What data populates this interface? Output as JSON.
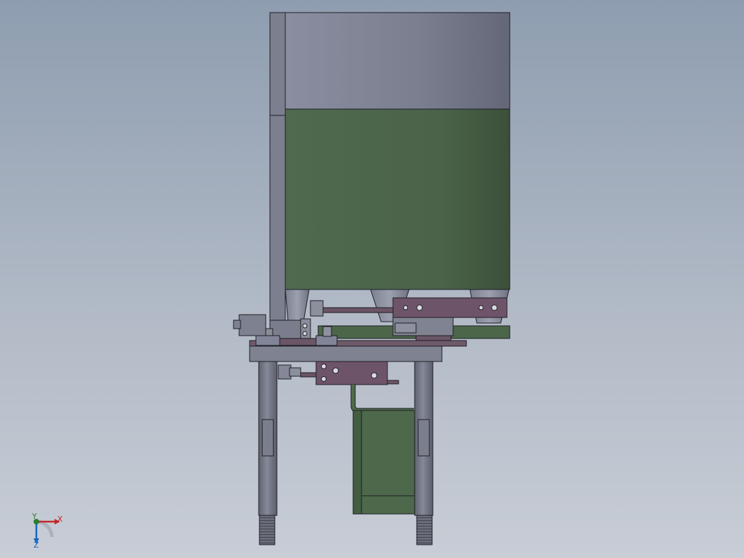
{
  "viewport": {
    "background_top": "#8e9db0",
    "background_bottom": "#c8cdd6"
  },
  "colors": {
    "hopper_steel": "#7a7f8e",
    "hopper_green": "#4f6a4e",
    "frame_gray": "#7c7f8c",
    "cylinder_purple": "#6e5468",
    "edge": "#1e1e24",
    "tube_green": "#4e6b4b"
  },
  "triad": {
    "x_label": "X",
    "y_label": "Y",
    "z_label": "Z",
    "x_color": "#c62828",
    "y_color": "#2e7d32",
    "z_color": "#1565c0"
  }
}
